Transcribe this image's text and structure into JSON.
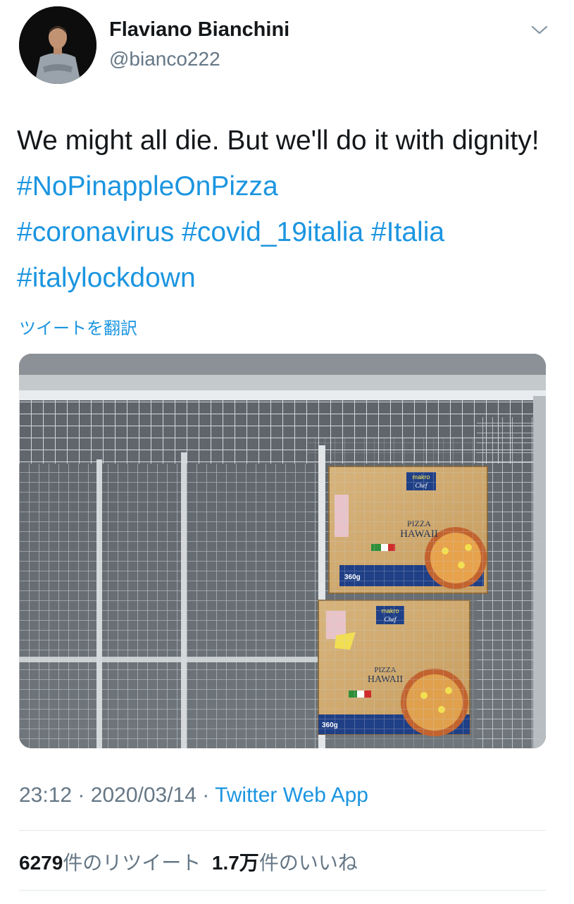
{
  "author": {
    "name": "Flaviano Bianchini",
    "handle": "@bianco222"
  },
  "tweet": {
    "text": "We might all die. But we'll do it with dignity!",
    "hashtags": [
      "#NoPinappleOnPizza",
      "#coronavirus",
      "#covid_19italia",
      "#Italia",
      "#italylockdown"
    ]
  },
  "translate_label": "ツイートを翻訳",
  "media": {
    "brand": "makro",
    "sub_brand": "Chef",
    "product_name_1": "PIZZA",
    "product_name_2": "HAWAII",
    "weight": "360g",
    "weight_lower": "360g"
  },
  "meta": {
    "time": "23:12",
    "date": "2020/03/14",
    "separator": "·",
    "source": "Twitter Web App"
  },
  "stats": {
    "retweets_count": "6279",
    "retweets_label": "件のリツイート",
    "likes_count": "1.7万",
    "likes_label": "件のいいね"
  },
  "colors": {
    "link": "#1b95e0",
    "secondary": "#657786",
    "text": "#14171a"
  }
}
